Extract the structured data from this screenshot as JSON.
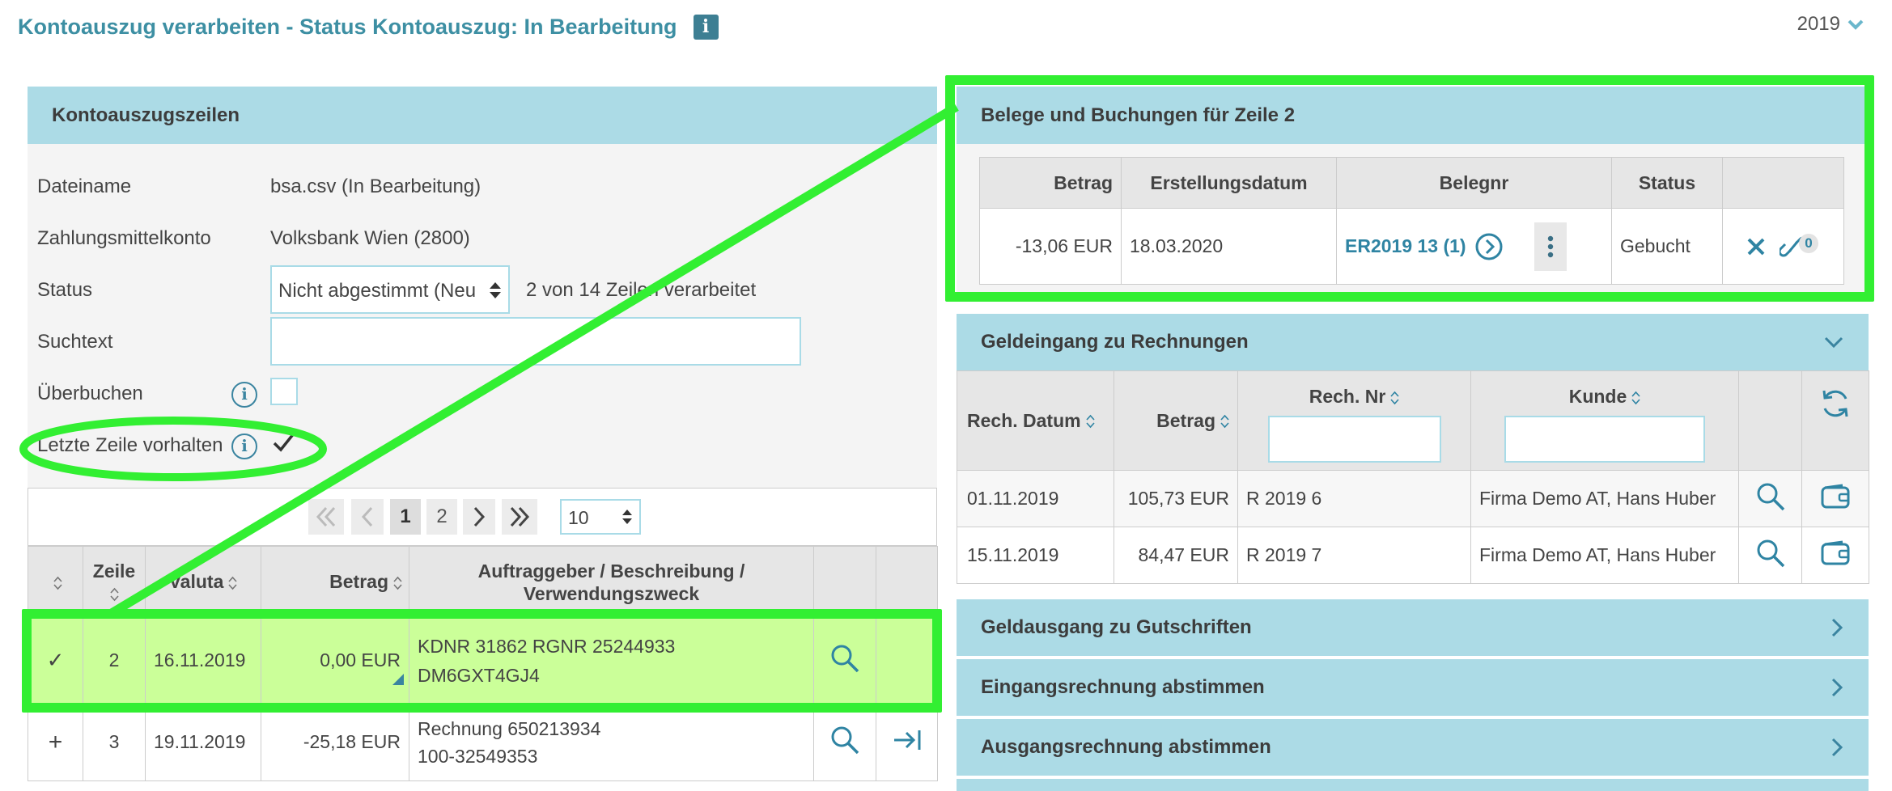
{
  "header": {
    "title": "Kontoauszug verarbeiten - Status Kontoauszug: In Bearbeitung",
    "info_glyph": "i",
    "year": "2019"
  },
  "left_panel": {
    "heading": "Kontoauszugszeilen",
    "fields": {
      "dateiname_label": "Dateiname",
      "dateiname_value": "bsa.csv (In Bearbeitung)",
      "konto_label": "Zahlungsmittelkonto",
      "konto_value": "Volksbank Wien (2800)",
      "status_label": "Status",
      "status_value": "Nicht abgestimmt (Neu &",
      "status_progress": "2 von 14 Zeilen verarbeitet",
      "suchtext_label": "Suchtext",
      "suchtext_value": "",
      "ueberbuchen_label": "Überbuchen",
      "letzte_label": "Letzte Zeile vorhalten"
    },
    "pager": {
      "first": "«",
      "prev": "‹",
      "pages": [
        "1",
        "2"
      ],
      "next": "›",
      "last": "»",
      "page_size": "10"
    },
    "table": {
      "headers": {
        "zeile": "Zeile",
        "valuta": "Valuta",
        "betrag": "Betrag",
        "beschreibung_1": "Auftraggeber / Beschreibung /",
        "beschreibung_2": "Verwendungszweck"
      },
      "rows": [
        {
          "mark": "✓",
          "zeile": "2",
          "valuta": "16.11.2019",
          "betrag": "0,00 EUR",
          "desc1": "KDNR 31862 RGNR 25244933",
          "desc2": "DM6GXT4GJ4"
        },
        {
          "mark": "+",
          "zeile": "3",
          "valuta": "19.11.2019",
          "betrag": "-25,18 EUR",
          "desc1": "Rechnung 650213934",
          "desc2": "100-32549353"
        }
      ]
    }
  },
  "belege": {
    "heading": "Belege und Buchungen für Zeile 2",
    "headers": {
      "betrag": "Betrag",
      "datum": "Erstellungsdatum",
      "belegnr": "Belegnr",
      "status": "Status"
    },
    "row": {
      "betrag": "-13,06 EUR",
      "datum": "18.03.2020",
      "belegnr": "ER2019 13 (1)",
      "status": "Gebucht",
      "link_count": "0"
    }
  },
  "geldeingang": {
    "heading": "Geldeingang zu Rechnungen",
    "headers": {
      "datum": "Rech. Datum",
      "betrag": "Betrag",
      "nr": "Rech. Nr",
      "kunde": "Kunde"
    },
    "filter_nr": "",
    "filter_kunde": "",
    "rows": [
      {
        "datum": "01.11.2019",
        "betrag": "105,73 EUR",
        "nr": "R 2019 6",
        "kunde": "Firma Demo AT, Hans Huber"
      },
      {
        "datum": "15.11.2019",
        "betrag": "84,47 EUR",
        "nr": "R 2019 7",
        "kunde": "Firma Demo AT, Hans Huber"
      }
    ]
  },
  "accordions": {
    "gutschriften": "Geldausgang zu Gutschriften",
    "eingang": "Eingangsrechnung abstimmen",
    "ausgang": "Ausgangsrechnung abstimmen"
  },
  "colors": {
    "accent": "#3d8fa3",
    "panel": "#acdbe6",
    "highlight_row": "#cbff99",
    "annotation": "#32ef32"
  }
}
